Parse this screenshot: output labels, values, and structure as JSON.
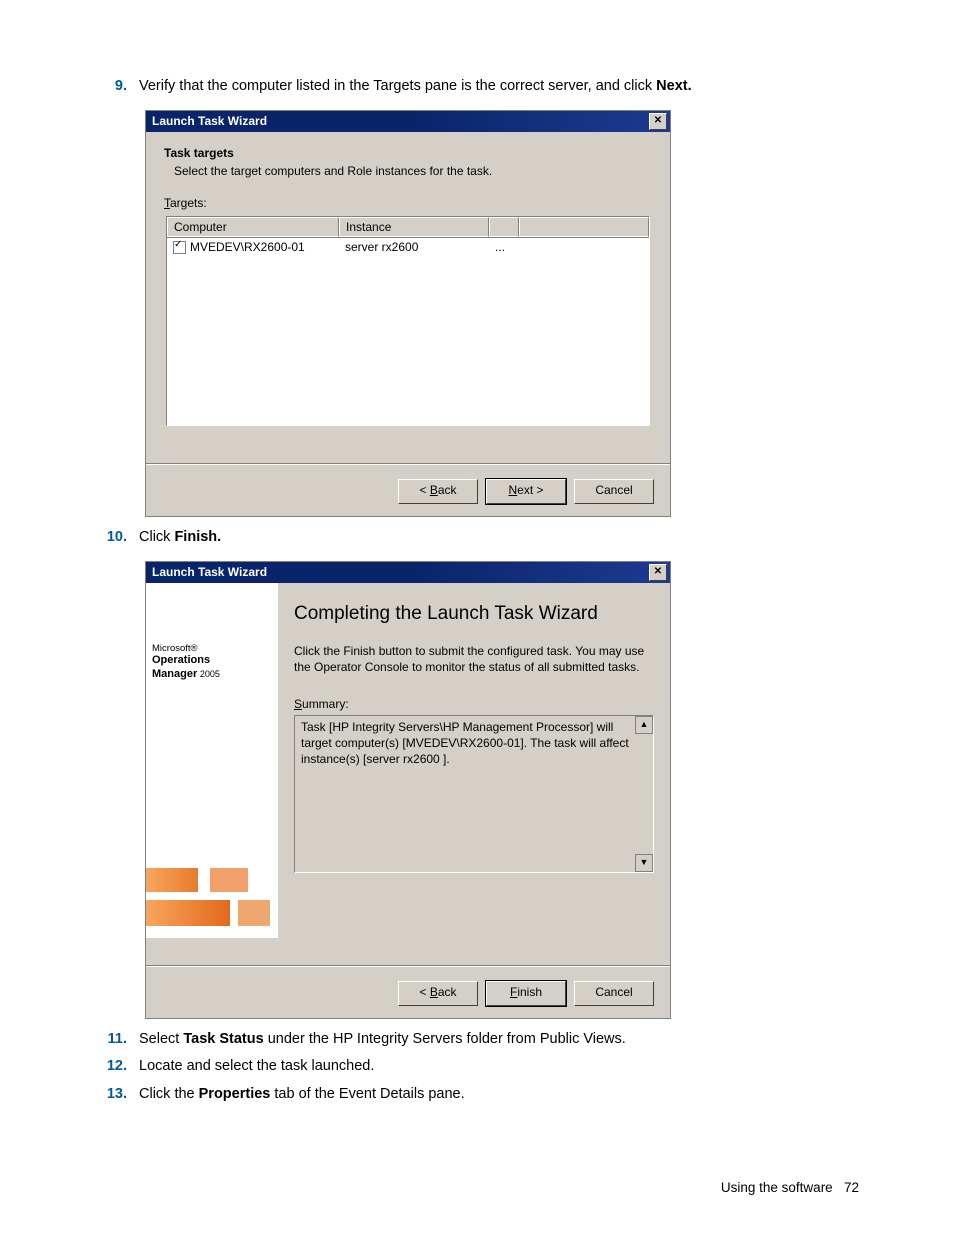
{
  "steps": {
    "s9": {
      "num": "9.",
      "text_a": "Verify that the computer listed in the Targets pane is the correct server, and click ",
      "bold": "Next."
    },
    "s10": {
      "num": "10.",
      "text_a": "Click ",
      "bold": "Finish."
    },
    "s11": {
      "num": "11.",
      "text_a": "Select ",
      "bold": "Task Status",
      "text_b": " under the HP Integrity Servers folder from Public Views."
    },
    "s12": {
      "num": "12.",
      "text": "Locate and select the task launched."
    },
    "s13": {
      "num": "13.",
      "text_a": "Click the ",
      "bold": "Properties",
      "text_b": " tab of the Event Details pane."
    }
  },
  "dlg1": {
    "title": "Launch Task Wizard",
    "header": "Task targets",
    "sub": "Select the target computers and Role instances for the task.",
    "targets_label_pre": "T",
    "targets_label_post": "argets:",
    "cols": {
      "a": "Computer",
      "b": "Instance"
    },
    "row": {
      "computer": "MVEDEV\\RX2600-01",
      "instance": "server rx2600",
      "ellipsis": "..."
    },
    "buttons": {
      "back_pre": "< ",
      "back_u": "B",
      "back_post": "ack",
      "next_u": "N",
      "next_post": "ext >",
      "cancel": "Cancel"
    }
  },
  "dlg2": {
    "title": "Launch Task Wizard",
    "logo": {
      "ms": "Microsoft®",
      "ops": "Operations",
      "mgr": "Manager",
      "year": "2005"
    },
    "heading": "Completing the Launch Task Wizard",
    "body": "Click the Finish button to submit the configured task. You may use the Operator Console to monitor the status of all submitted tasks.",
    "summary_u": "S",
    "summary_post": "ummary:",
    "summary_text": "Task [HP Integrity Servers\\HP Management Processor] will target computer(s) [MVEDEV\\RX2600-01]. The task will affect instance(s) [server rx2600               ].",
    "buttons": {
      "back_pre": "< ",
      "back_u": "B",
      "back_post": "ack",
      "finish_u": "F",
      "finish_post": "inish",
      "cancel": "Cancel"
    }
  },
  "footer": {
    "label": "Using the software",
    "page": "72"
  }
}
